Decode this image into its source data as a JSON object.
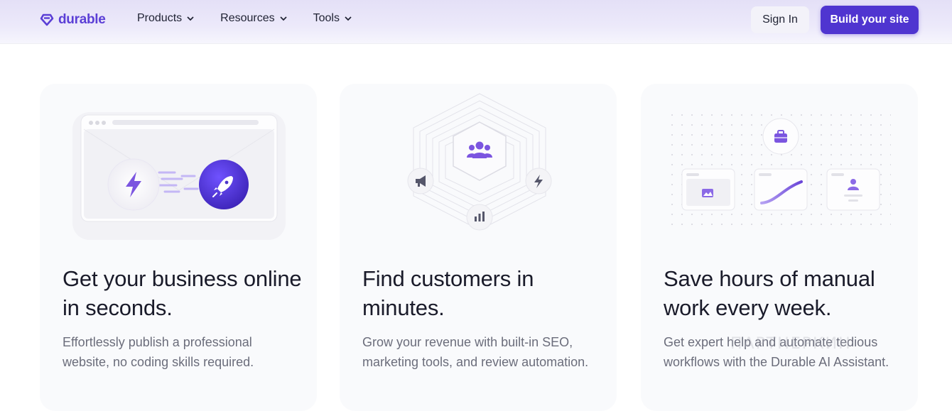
{
  "brand": {
    "name": "durable",
    "color": "#5b3fd6",
    "logo_icon": "durable-heart-logo-icon"
  },
  "nav": {
    "items": [
      {
        "label": "Products",
        "icon": "chevron-down-icon"
      },
      {
        "label": "Resources",
        "icon": "chevron-down-icon"
      },
      {
        "label": "Tools",
        "icon": "chevron-down-icon"
      }
    ]
  },
  "header_actions": {
    "signin_label": "Sign In",
    "build_label": "Build your site",
    "accent": "#4f35d0"
  },
  "cards": [
    {
      "title": "Get your business online in seconds.",
      "description": "Effortlessly publish a professional website, no coding skills required.",
      "icons": [
        "lightning-icon",
        "rocket-icon"
      ]
    },
    {
      "title": "Find customers in minutes.",
      "description": "Grow your revenue with built-in SEO, marketing tools, and review automation.",
      "icons": [
        "users-icon",
        "megaphone-icon",
        "lightning-icon",
        "bar-chart-icon"
      ]
    },
    {
      "title": "Save hours of manual work every week.",
      "description": "Get expert help and automate tedious workflows with the Durable AI Assistant.",
      "icons": [
        "briefcase-icon",
        "image-icon",
        "user-icon"
      ]
    }
  ],
  "watermark": "ПАРТНЕРКИН"
}
